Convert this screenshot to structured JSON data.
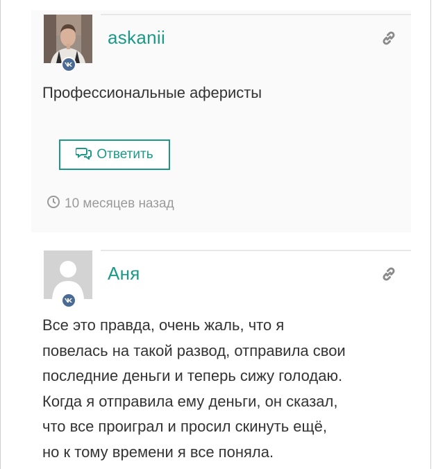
{
  "comments": [
    {
      "author": "askanii",
      "text": "Профессиональные аферисты",
      "reply_label": "Ответить",
      "time": "10 месяцев назад"
    },
    {
      "author": "Аня",
      "text_lines": [
        "Все это правда, очень жаль, что я",
        "повелась на такой развод, отправила свои",
        "последние деньги и теперь сижу голодаю.",
        "Когда я отправила ему деньги, он сказал,",
        "что все проиграл и просил скинуть ещё,",
        "но к тому времени я все поняла."
      ]
    }
  ],
  "colors": {
    "accent": "#1a9a86",
    "vk_badge": "#4a6b93",
    "muted": "#9a9a9a"
  },
  "icons": [
    "vk-badge-icon",
    "permalink-icon",
    "speech-bubbles-icon",
    "clock-icon"
  ]
}
